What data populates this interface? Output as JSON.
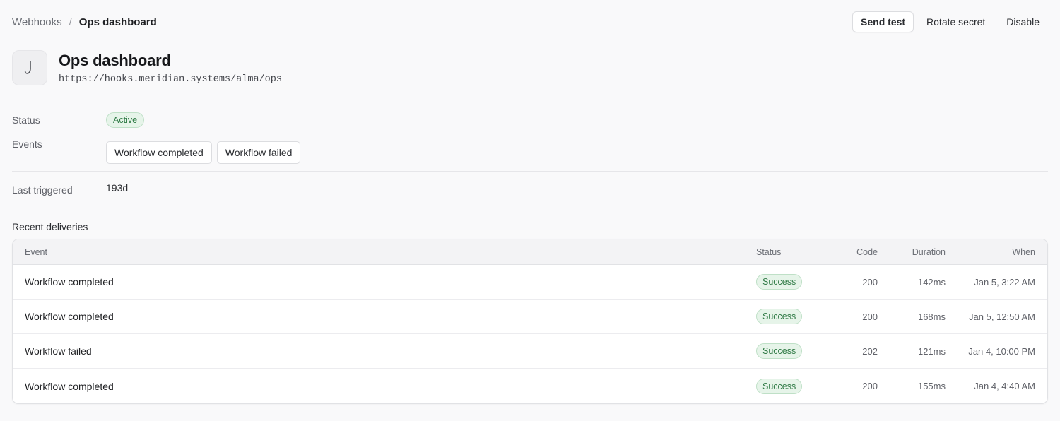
{
  "breadcrumb": {
    "parent": "Webhooks",
    "separator": "/",
    "current": "Ops dashboard"
  },
  "actions": {
    "send_test": "Send test",
    "rotate_secret": "Rotate secret",
    "disable": "Disable"
  },
  "webhook": {
    "icon": "hook-icon",
    "title": "Ops dashboard",
    "url": "https://hooks.meridian.systems/alma/ops"
  },
  "details": {
    "status_label": "Status",
    "status_value": "Active",
    "events_label": "Events",
    "events": [
      "Workflow completed",
      "Workflow failed"
    ],
    "last_triggered_label": "Last triggered",
    "last_triggered_value": "193d"
  },
  "deliveries": {
    "title": "Recent deliveries",
    "columns": {
      "event": "Event",
      "status": "Status",
      "code": "Code",
      "duration": "Duration",
      "when": "When"
    },
    "rows": [
      {
        "event": "Workflow completed",
        "status": "Success",
        "code": "200",
        "duration": "142ms",
        "when": "Jan 5, 3:22 AM"
      },
      {
        "event": "Workflow completed",
        "status": "Success",
        "code": "200",
        "duration": "168ms",
        "when": "Jan 5, 12:50 AM"
      },
      {
        "event": "Workflow failed",
        "status": "Success",
        "code": "202",
        "duration": "121ms",
        "when": "Jan 4, 10:00 PM"
      },
      {
        "event": "Workflow completed",
        "status": "Success",
        "code": "200",
        "duration": "155ms",
        "when": "Jan 4, 4:40 AM"
      }
    ]
  },
  "colors": {
    "success_text": "#2f7a45",
    "success_bg": "#e6f4e9",
    "page_bg": "#f9f9fa"
  }
}
